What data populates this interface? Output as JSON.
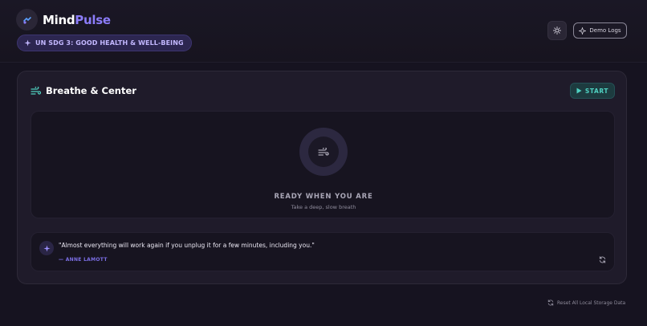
{
  "header": {
    "brand_part1": "Mind",
    "brand_part2": "Pulse",
    "sdg_badge": "UN SDG 3: GOOD HEALTH & WELL-BEING",
    "demo_logs_label": "Demo Logs"
  },
  "breathe": {
    "title": "Breathe & Center",
    "start_label": "START",
    "status": "READY WHEN YOU ARE",
    "instruction": "Take a deep, slow breath"
  },
  "quote": {
    "text": "\"Almost everything will work again if you unplug it for a few minutes, including you.\"",
    "author": "— ANNE LAMOTT"
  },
  "footer": {
    "reset_label": "Reset All Local Storage Data"
  },
  "icons": {
    "logo": "pulse-logo-icon",
    "sparkle": "sparkle-icon",
    "theme": "sun-icon",
    "wind": "wind-icon",
    "play": "play-icon",
    "refresh": "refresh-icon"
  },
  "colors": {
    "background": "#161320",
    "accent_purple": "#8b7cf8",
    "accent_teal": "#4fd1c1",
    "card": "#1f1b2a"
  }
}
